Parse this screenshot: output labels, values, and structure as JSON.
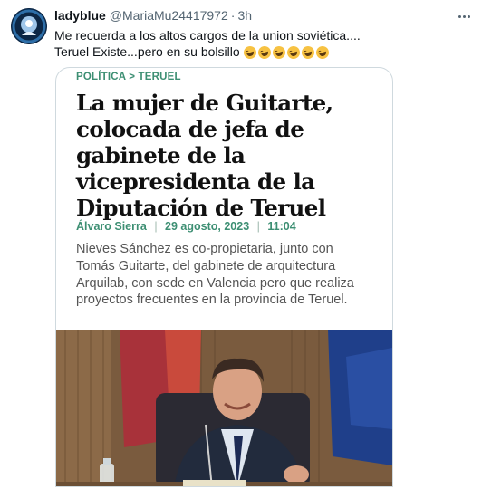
{
  "tweet": {
    "display_name": "ladyblue",
    "handle": "@MariaMu24417972",
    "separator": "·",
    "time": "3h",
    "text_line1": "Me recuerda a los altos cargos de la union soviética....",
    "text_line2": "Teruel Existe...pero en su bolsillo",
    "emoji_name": "rolling-on-floor-laughing",
    "emoji_count": 6
  },
  "article": {
    "section": "POLÍTICA > TERUEL",
    "headline_lines": [
      "La mujer de Guitarte,",
      "colocada de jefa de",
      "gabinete de la",
      "vicepresidenta de la",
      "Diputación de Teruel"
    ],
    "author": "Álvaro Sierra",
    "date": "29 agosto, 2023",
    "time": "11:04",
    "byline_separator": "|",
    "summary_lines": [
      "Nieves Sánchez es co-propietaria, junto con",
      "Tomás Guitarte, del gabinete de arquitectura",
      "Arquilab, con sede en Valencia pero que realiza",
      "proyectos frecuentes en la provincia de Teruel."
    ]
  },
  "colors": {
    "accent_green": "#3d8f73",
    "text_secondary": "#536471",
    "card_border": "#cfd9de"
  }
}
